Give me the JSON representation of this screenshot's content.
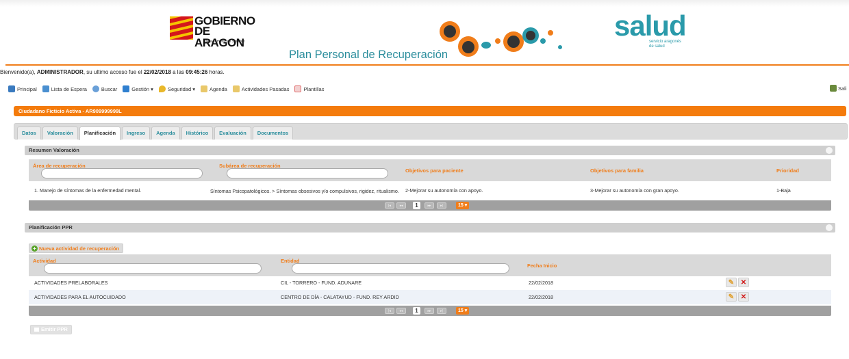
{
  "header": {
    "gobierno_line1": "GOBIERNO",
    "gobierno_line2": "DE ARAGON",
    "gobierno_sub": "Departamento de Sanidad",
    "app_title": "Plan Personal de Recuperación",
    "salud_word": "salud",
    "salud_sub1": "servicio aragonés",
    "salud_sub2": "de salud"
  },
  "welcome": {
    "prefix": "Bienvenido(a), ",
    "user": "ADMINISTRADOR",
    "middle": ", su ultimo acceso fue el ",
    "date": "22/02/2018",
    "sep": " a las ",
    "time": "09:45:26",
    "suffix": " horas."
  },
  "menu": {
    "items": [
      {
        "label": "Principal",
        "icon": "home-icon",
        "color": "#3a7abf"
      },
      {
        "label": "Lista de Espera",
        "icon": "list-icon",
        "color": "#4a8fd0"
      },
      {
        "label": "Buscar",
        "icon": "search-icon",
        "color": "#6aa0d8"
      },
      {
        "label": "Gestión ▾",
        "icon": "folder-icon",
        "color": "#2f7fcf"
      },
      {
        "label": "Seguridad ▾",
        "icon": "shield-icon",
        "color": "#e9b82a"
      },
      {
        "label": "Agenda",
        "icon": "calendar-icon",
        "color": "#e9c86a"
      },
      {
        "label": "Actividades Pasadas",
        "icon": "history-icon",
        "color": "#e9c86a"
      },
      {
        "label": "Plantillas",
        "icon": "template-icon",
        "color": "#e07070"
      }
    ],
    "exit_label": "Sali"
  },
  "patient": {
    "label": "Ciudadano Ficticio Activa - AR909999999L"
  },
  "tabs": [
    {
      "label": "Datos"
    },
    {
      "label": "Valoración"
    },
    {
      "label": "Planificación"
    },
    {
      "label": "Ingreso"
    },
    {
      "label": "Agenda"
    },
    {
      "label": "Histórico"
    },
    {
      "label": "Evaluación"
    },
    {
      "label": "Documentos"
    }
  ],
  "resumen": {
    "title": "Resumen Valoración",
    "columns": [
      "Área de recuperación",
      "Subárea de recuperación",
      "Objetivos para paciente",
      "Objetivos para familia",
      "Prioridad"
    ],
    "rows": [
      {
        "area": "1. Manejo de síntomas de la enfermedad mental.",
        "subarea": "Síntomas Psicopatológicos. > Síntomas obsesivos y/o compulsivos, rigidez, ritualismo.",
        "obj_paciente": "2-Mejorar su autonomía con apoyo.",
        "obj_familia": "3-Mejorar su autonomía con gran apoyo.",
        "prioridad": "1-Baja"
      }
    ],
    "pager": {
      "current": "1",
      "page_size": "15 ▾"
    }
  },
  "ppr": {
    "title": "Planificación PPR",
    "new_button": "Nueva actividad de recuperación",
    "columns": [
      "Actividad",
      "Entidad",
      "Fecha Inicio"
    ],
    "rows": [
      {
        "actividad": "ACTIVIDADES PRELABORALES",
        "entidad": "CIL - TORRERO - FUND. ADUNARE",
        "fecha": "22/02/2018"
      },
      {
        "actividad": "ACTIVIDADES PARA EL AUTOCUIDADO",
        "entidad": "CENTRO DE DÍA - CALATAYUD - FUND. REY ARDID",
        "fecha": "22/02/2018"
      }
    ],
    "pager": {
      "current": "1",
      "page_size": "15 ▾"
    },
    "emit_button": "Emitir PPR"
  },
  "colors": {
    "accent_orange": "#f07d1a",
    "teal": "#2a8d9c"
  }
}
